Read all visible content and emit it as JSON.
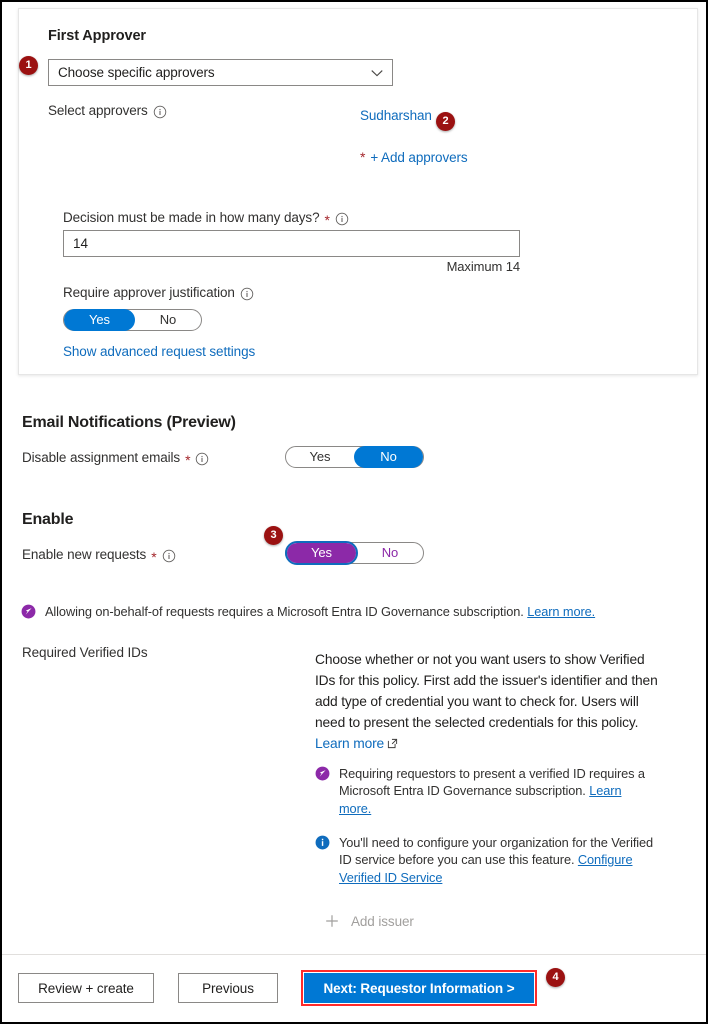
{
  "card": {
    "title": "First Approver",
    "approver_type": {
      "selected": "Choose specific approvers",
      "chevron_icon": "chevron-down-icon"
    },
    "select_approvers": {
      "label": "Select approvers",
      "info_icon": "info-icon",
      "chosen_approver": "Sudharshan",
      "required_marker": "*",
      "add_link": "+ Add approvers"
    },
    "decision_days": {
      "label": "Decision must be made in how many days?",
      "required_marker": "*",
      "info_icon": "info-icon",
      "value": "14",
      "maximum_hint": "Maximum 14"
    },
    "require_justification": {
      "label": "Require approver justification",
      "info_icon": "info-icon",
      "options": [
        "Yes",
        "No"
      ],
      "selected": "Yes"
    },
    "advanced_link": "Show advanced request settings"
  },
  "email_notifications": {
    "heading": "Email Notifications (Preview)",
    "disable_assignment_emails": {
      "label": "Disable assignment emails",
      "required_marker": "*",
      "info_icon": "info-icon",
      "options": [
        "Yes",
        "No"
      ],
      "selected": "No"
    }
  },
  "enable": {
    "heading": "Enable",
    "enable_new_requests": {
      "label": "Enable new requests",
      "required_marker": "*",
      "info_icon": "info-icon",
      "options": [
        "Yes",
        "No"
      ],
      "selected": "Yes"
    },
    "notice": {
      "icon": "entra-governance-badge-icon",
      "text": "Allowing on-behalf-of requests requires a Microsoft Entra ID Governance subscription.",
      "link": "Learn more."
    }
  },
  "required_verified_ids": {
    "label": "Required Verified IDs",
    "description": "Choose whether or not you want users to show Verified IDs for this policy. First add the issuer's identifier and then add type of credential you want to check for. Users will need to present the selected credentials for this policy.",
    "description_link": "Learn more",
    "external_link_icon": "external-link-icon",
    "governance_notice": {
      "icon": "entra-governance-badge-icon",
      "text": "Requiring requestors to present a verified ID requires a Microsoft Entra ID Governance subscription.",
      "link": "Learn more."
    },
    "info_notice": {
      "icon": "info-filled-icon",
      "text": "You'll need to configure your organization for the Verified ID service before you can use this feature.",
      "link": "Configure Verified ID Service"
    },
    "add_issuer": {
      "icon": "plus-icon",
      "label": "Add issuer",
      "disabled": true
    }
  },
  "footer": {
    "review_create": "Review + create",
    "previous": "Previous",
    "next": "Next: Requestor Information >"
  },
  "callouts": {
    "one": "1",
    "two": "2",
    "three": "3",
    "four": "4"
  },
  "colors": {
    "accent_blue": "#0078d4",
    "link_blue": "#0f6cbd",
    "purple": "#8c29a8",
    "required_red": "#a4262c",
    "badge_red": "#9b1111",
    "highlight_red": "#ff2b2b"
  }
}
